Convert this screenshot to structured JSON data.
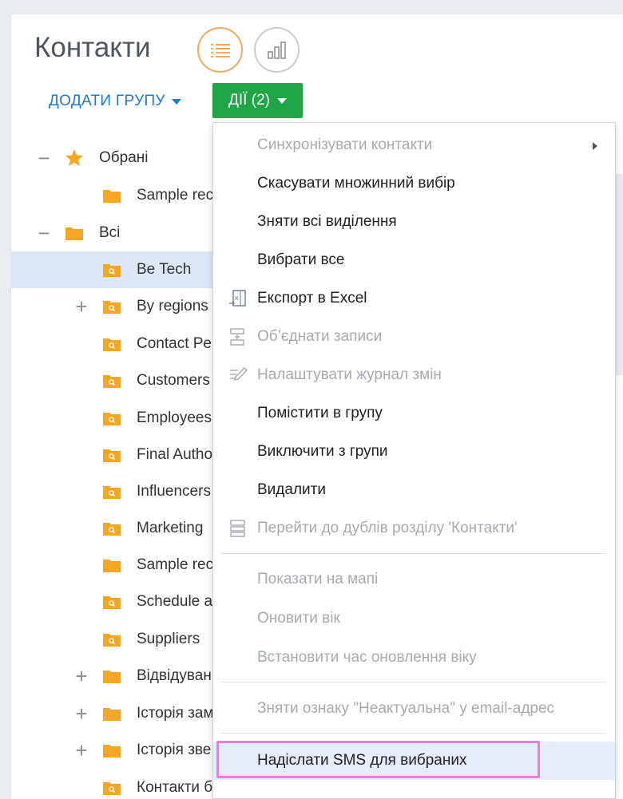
{
  "page": {
    "title": "Контакти"
  },
  "toolbar": {
    "add_group_label": "ДОДАТИ ГРУПУ",
    "actions_label": "ДІЇ (2)"
  },
  "view_icons": [
    "list-view-icon",
    "chart-view-icon"
  ],
  "tree": {
    "favorites_label": "Обрані",
    "items": [
      {
        "label": "Sample rec",
        "type": "folder"
      },
      {
        "label": "Всі",
        "type": "folder"
      },
      {
        "label": "Be Tech",
        "type": "search-folder",
        "selected": true
      },
      {
        "label": "By regions",
        "type": "search-folder"
      },
      {
        "label": "Contact Pe",
        "type": "search-folder"
      },
      {
        "label": "Customers",
        "type": "search-folder"
      },
      {
        "label": "Employees",
        "type": "search-folder"
      },
      {
        "label": "Final Autho",
        "type": "search-folder"
      },
      {
        "label": "Influencers",
        "type": "search-folder"
      },
      {
        "label": "Marketing",
        "type": "search-folder"
      },
      {
        "label": "Sample rec",
        "type": "folder"
      },
      {
        "label": "Schedule a",
        "type": "search-folder"
      },
      {
        "label": "Suppliers",
        "type": "search-folder"
      },
      {
        "label": "Відвідуван",
        "type": "folder"
      },
      {
        "label": "Історія зам",
        "type": "folder"
      },
      {
        "label": "Історія зве",
        "type": "folder"
      },
      {
        "label": "Контакти без активних лідів",
        "type": "search-folder"
      }
    ]
  },
  "menu": {
    "items": [
      {
        "label": "Синхронізувати контакти",
        "disabled": true,
        "submenu": true
      },
      {
        "label": "Скасувати множинний вибір"
      },
      {
        "label": "Зняти всі виділення"
      },
      {
        "label": "Вибрати все"
      },
      {
        "label": "Експорт в Excel",
        "icon": "excel-export-icon"
      },
      {
        "label": "Об’єднати записи",
        "icon": "merge-records-icon",
        "disabled": true
      },
      {
        "label": "Налаштувати журнал змін",
        "icon": "edit-log-icon",
        "disabled": true
      },
      {
        "label": "Помістити в групу"
      },
      {
        "label": "Виключити з групи"
      },
      {
        "label": "Видалити"
      },
      {
        "label": "Перейти до дублів розділу 'Контакти'",
        "icon": "duplicates-icon",
        "disabled": true
      },
      {
        "label": "Показати на мапі",
        "disabled": true
      },
      {
        "label": "Оновити вік",
        "disabled": true
      },
      {
        "label": "Встановити час оновлення віку",
        "disabled": true
      },
      {
        "label": "Зняти ознаку \"Неактуальна\" у email-адрес",
        "disabled": true
      },
      {
        "label": "Надіслати SMS для вибраних",
        "highlighted": true
      }
    ]
  },
  "colors": {
    "accent_green": "#20a647",
    "link_blue": "#1b7bd1",
    "folder_orange": "#f7a623",
    "highlight_border": "#ee7be6",
    "selected_row": "#dde7f7"
  }
}
